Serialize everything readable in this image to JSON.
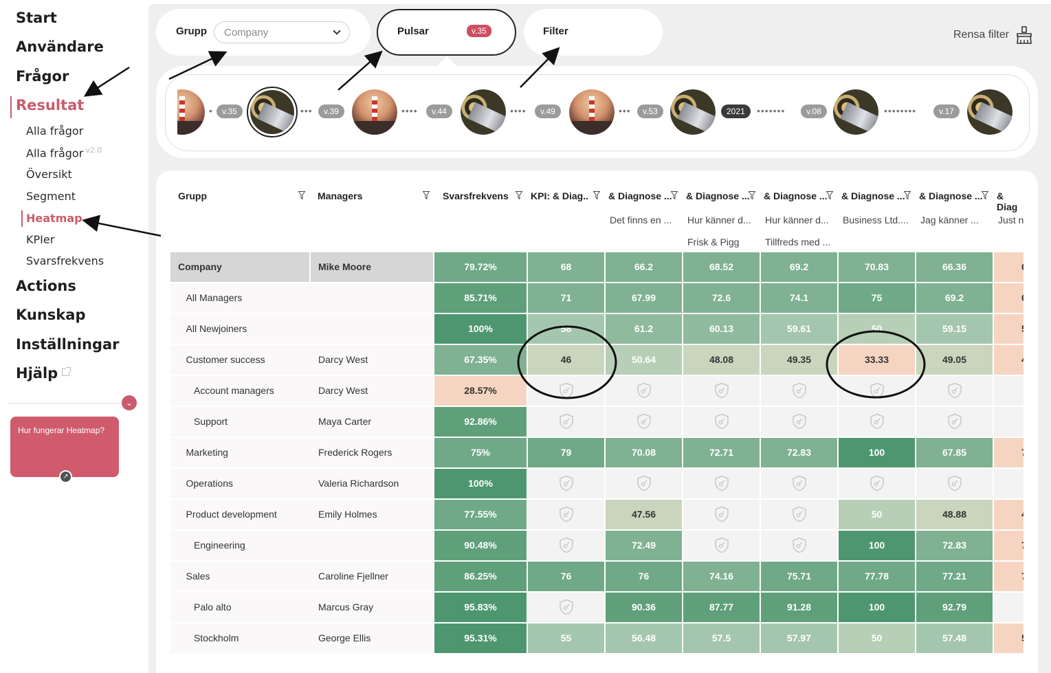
{
  "sidebar": {
    "main_items": [
      "Start",
      "Användare",
      "Frågor",
      "Resultat",
      "Actions",
      "Kunskap",
      "Inställningar",
      "Hjälp"
    ],
    "sub_items": [
      "Alla frågor",
      "Alla frågor",
      "Översikt",
      "Segment",
      "Heatmap",
      "KPIer",
      "Svarsfrekvens"
    ],
    "sub_sup": "v2.0",
    "active_main": "Resultat",
    "active_sub": "Heatmap",
    "help_card": "Hur fungerar Heatmap?"
  },
  "toolbar": {
    "group_label": "Grupp",
    "group_value": "Company",
    "pulsar_label": "Pulsar",
    "pulsar_badge": "v.35",
    "filter_label": "Filter",
    "clear_label": "Rensa filter"
  },
  "timeline": {
    "badges": [
      "v.35",
      "v.39",
      "v.44",
      "v.49",
      "v.53",
      "2021",
      "v.08",
      "v.17"
    ]
  },
  "table": {
    "columns": [
      "Grupp",
      "Managers",
      "Svarsfrekvens",
      "KPI: & Diag..",
      "& Diagnose ...",
      "& Diagnose ...",
      "& Diagnose ...",
      "& Diagnose ...",
      "& Diagnose ...",
      "& Diag"
    ],
    "subheaders": [
      [
        "",
        "",
        "",
        "",
        "Det finns en ...",
        "Hur känner d...",
        "Hur känner d...",
        "Business Ltd....",
        "Jag känner ...",
        "Just n"
      ],
      [
        "",
        "",
        "",
        "",
        "",
        "Frisk & Pigg",
        "Tillfreds med ...",
        "",
        "",
        ""
      ]
    ],
    "rows": [
      {
        "group": "Company",
        "manager": "Mike Moore",
        "values": [
          "79.72%",
          "68",
          "66.2",
          "68.52",
          "69.2",
          "70.83",
          "66.36",
          "6"
        ]
      },
      {
        "group": "All Managers",
        "manager": "",
        "values": [
          "85.71%",
          "71",
          "67.99",
          "72.6",
          "74.1",
          "75",
          "69.2",
          "6"
        ]
      },
      {
        "group": "All Newjoiners",
        "manager": "",
        "values": [
          "100%",
          "58",
          "61.2",
          "60.13",
          "59.61",
          "50",
          "59.15",
          "5"
        ]
      },
      {
        "group": "Customer success",
        "manager": "Darcy West",
        "values": [
          "67.35%",
          "46",
          "50.64",
          "48.08",
          "49.35",
          "33.33",
          "49.05",
          "4"
        ]
      },
      {
        "group": "Account managers",
        "manager": "Darcy West",
        "values": [
          "28.57%",
          "",
          "",
          "",
          "",
          "",
          "",
          ""
        ]
      },
      {
        "group": "Support",
        "manager": "Maya Carter",
        "values": [
          "92.86%",
          "",
          "",
          "",
          "",
          "",
          "",
          ""
        ]
      },
      {
        "group": "Marketing",
        "manager": "Frederick Rogers",
        "values": [
          "75%",
          "79",
          "70.08",
          "72.71",
          "72.83",
          "100",
          "67.85",
          "7"
        ]
      },
      {
        "group": "Operations",
        "manager": "Valeria Richardson",
        "values": [
          "100%",
          "",
          "",
          "",
          "",
          "",
          "",
          ""
        ]
      },
      {
        "group": "Product development",
        "manager": "Emily Holmes",
        "values": [
          "77.55%",
          "",
          "47.56",
          "",
          "",
          "50",
          "48.88",
          "4"
        ]
      },
      {
        "group": "Engineering",
        "manager": "",
        "values": [
          "90.48%",
          "",
          "72.49",
          "",
          "",
          "100",
          "72.83",
          "7"
        ]
      },
      {
        "group": "Sales",
        "manager": "Caroline Fjellner",
        "values": [
          "86.25%",
          "76",
          "76",
          "74.16",
          "75.71",
          "77.78",
          "77.21",
          "7"
        ]
      },
      {
        "group": "Palo alto",
        "manager": "Marcus Gray",
        "values": [
          "95.83%",
          "",
          "90.36",
          "87.77",
          "91.28",
          "100",
          "92.79",
          ""
        ]
      },
      {
        "group": "Stockholm",
        "manager": "George Ellis",
        "values": [
          "95.31%",
          "55",
          "56.48",
          "57.5",
          "57.97",
          "50",
          "57.48",
          "5"
        ]
      }
    ]
  },
  "colors": {
    "accent": "#c95b6c",
    "low": "#f5d5c2",
    "mid": "#c7d6be",
    "high": "#4e9670"
  }
}
